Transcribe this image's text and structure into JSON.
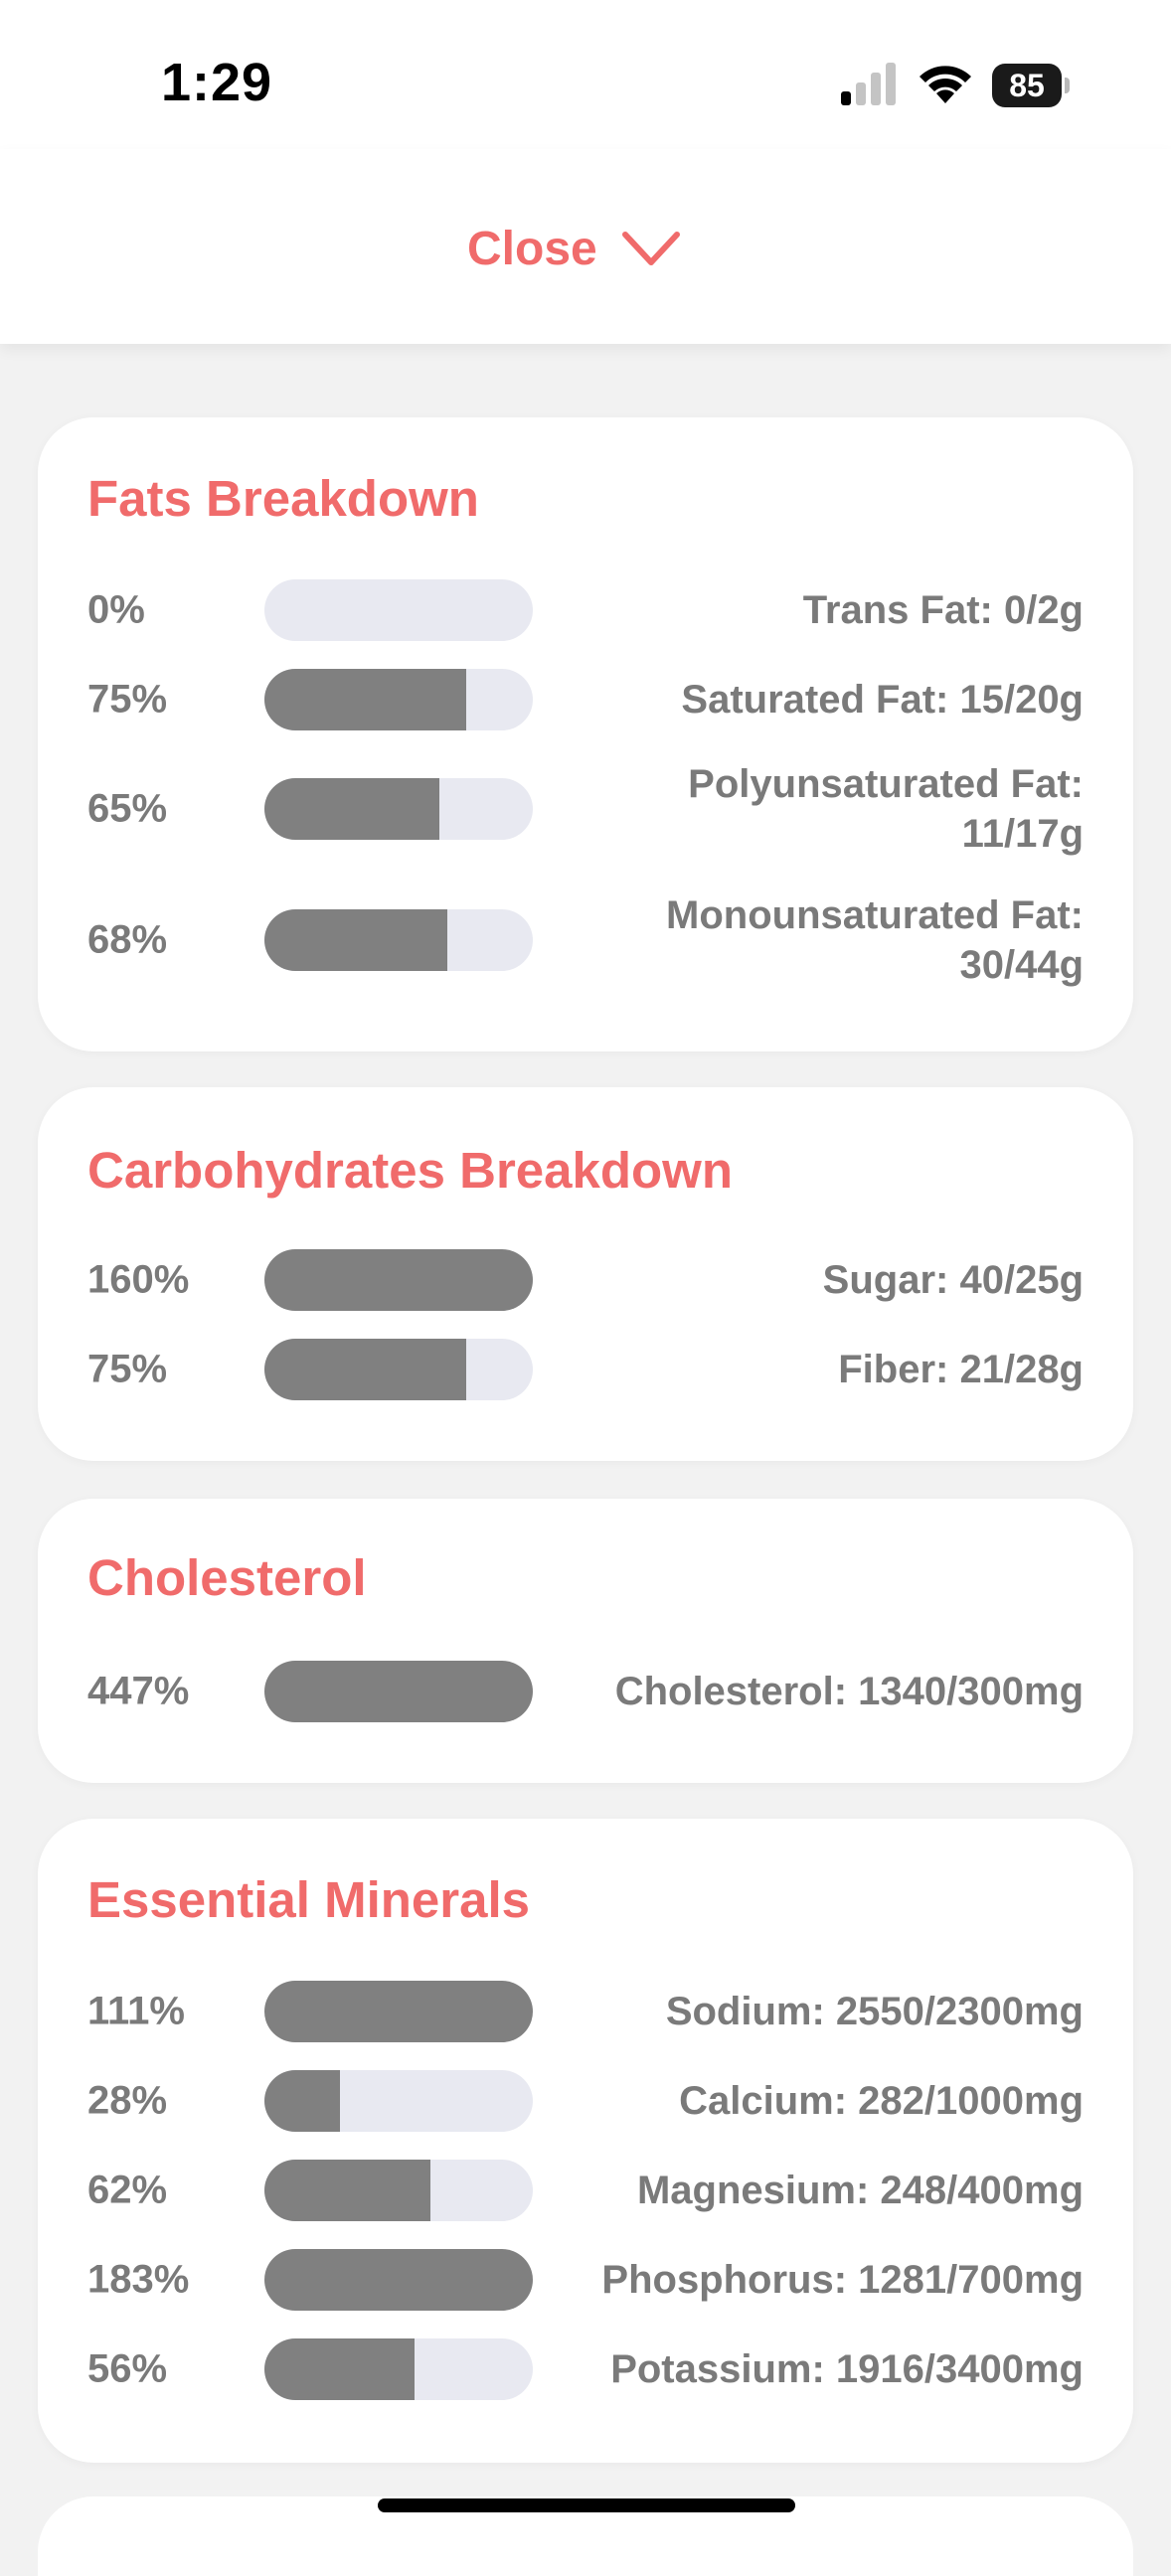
{
  "status_bar": {
    "time": "1:29",
    "battery": "85"
  },
  "header": {
    "close_label": "Close"
  },
  "colors": {
    "accent": "#f06b6b",
    "bar_fill": "#808080",
    "bar_track": "#e8e9f1",
    "text_gray": "#7a7a7a"
  },
  "sections": [
    {
      "title": "Fats Breakdown",
      "rows": [
        {
          "percent": "0%",
          "fill": 0.0,
          "label": "Trans Fat: 0/2g"
        },
        {
          "percent": "75%",
          "fill": 0.75,
          "label": "Saturated Fat: 15/20g"
        },
        {
          "percent": "65%",
          "fill": 0.65,
          "label": "Polyunsaturated Fat: 11/17g"
        },
        {
          "percent": "68%",
          "fill": 0.68,
          "label": "Monounsaturated Fat: 30/44g"
        }
      ]
    },
    {
      "title": "Carbohydrates Breakdown",
      "rows": [
        {
          "percent": "160%",
          "fill": 1.0,
          "label": "Sugar: 40/25g"
        },
        {
          "percent": "75%",
          "fill": 0.75,
          "label": "Fiber: 21/28g"
        }
      ]
    },
    {
      "title": "Cholesterol",
      "rows": [
        {
          "percent": "447%",
          "fill": 1.0,
          "label": "Cholesterol: 1340/300mg"
        }
      ]
    },
    {
      "title": "Essential Minerals",
      "rows": [
        {
          "percent": "111%",
          "fill": 1.0,
          "label": "Sodium: 2550/2300mg"
        },
        {
          "percent": "28%",
          "fill": 0.28,
          "label": "Calcium: 282/1000mg"
        },
        {
          "percent": "62%",
          "fill": 0.62,
          "label": "Magnesium: 248/400mg"
        },
        {
          "percent": "183%",
          "fill": 1.0,
          "label": "Phosphorus: 1281/700mg"
        },
        {
          "percent": "56%",
          "fill": 0.56,
          "label": "Potassium: 1916/3400mg"
        }
      ]
    }
  ]
}
